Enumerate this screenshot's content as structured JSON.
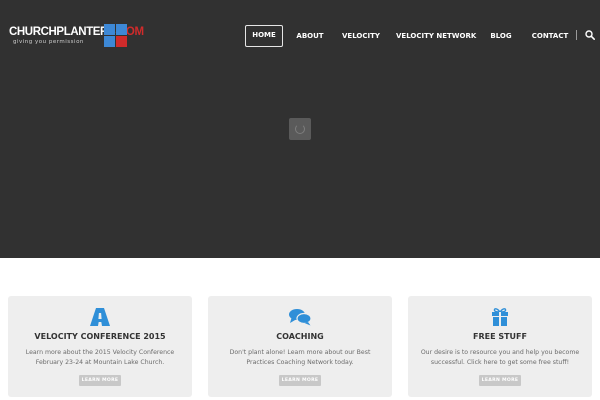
{
  "logo": {
    "name": "CHURCHPLANTERS",
    "domain": ".COM",
    "tagline": "giving you permission",
    "colors": [
      "#3d88d6",
      "#3d88d6",
      "#3d88d6",
      "#cf2b2b"
    ]
  },
  "nav": {
    "items": [
      {
        "label": "HOME",
        "active": true
      },
      {
        "label": "ABOUT",
        "active": false
      },
      {
        "label": "VELOCITY",
        "active": false
      },
      {
        "label": "VELOCITY NETWORK",
        "active": false
      },
      {
        "label": "BLOG",
        "active": false
      },
      {
        "label": "CONTACT",
        "active": false
      }
    ],
    "search_icon": "search-icon"
  },
  "hero": {
    "background": "#313131",
    "loader_icon": "loading-spinner-icon"
  },
  "cards": [
    {
      "icon": "road-icon",
      "title": "VELOCITY CONFERENCE 2015",
      "text": "Learn more about the 2015 Velocity Conference February 23-24 at Mountain Lake Church.",
      "button": "LEARN MORE"
    },
    {
      "icon": "chat-bubbles-icon",
      "title": "COACHING",
      "text": "Don't plant alone! Learn more about our Best Practices Coaching Network today.",
      "button": "LEARN MORE"
    },
    {
      "icon": "gift-icon",
      "title": "FREE STUFF",
      "text": "Our desire is to resource you and help you become successful. Click here to get some free stuff!",
      "button": "LEARN MORE"
    }
  ],
  "accent_color": "#2f8fd8"
}
